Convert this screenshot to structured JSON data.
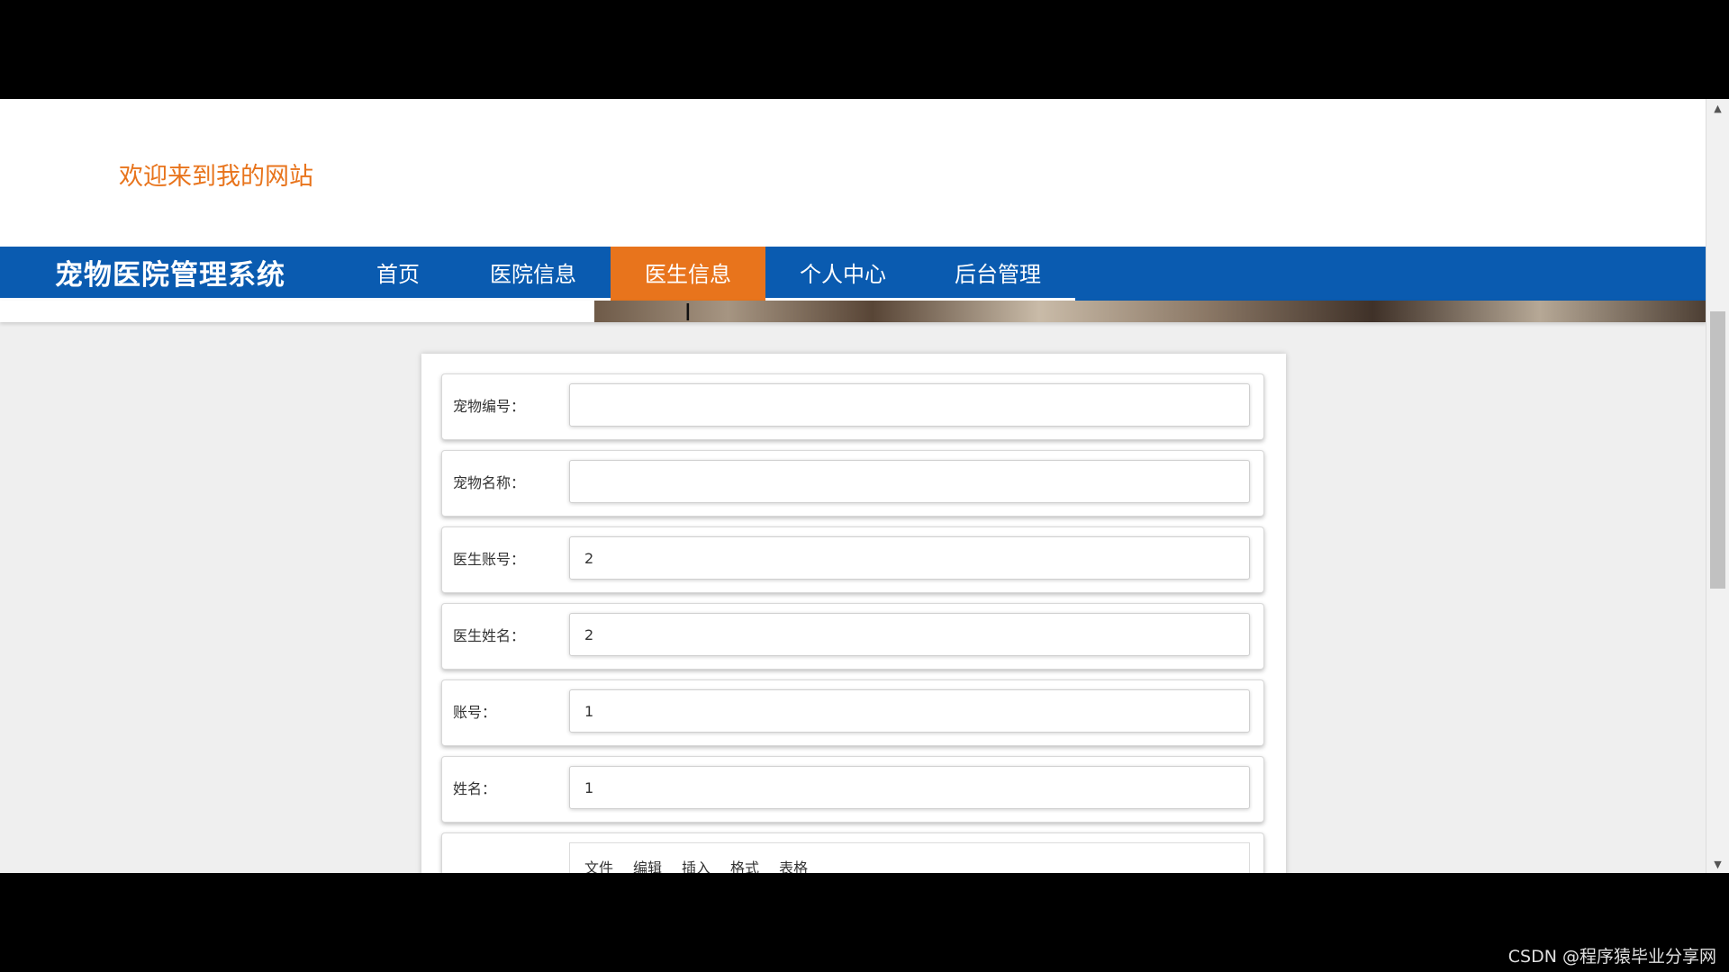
{
  "header": {
    "welcome": "欢迎来到我的网站"
  },
  "nav": {
    "brand": "宠物医院管理系统",
    "items": [
      {
        "label": "首页",
        "active": false
      },
      {
        "label": "医院信息",
        "active": false
      },
      {
        "label": "医生信息",
        "active": true
      },
      {
        "label": "个人中心",
        "active": false
      },
      {
        "label": "后台管理",
        "active": false
      }
    ]
  },
  "form": {
    "fields": [
      {
        "label": "宠物编号：",
        "value": ""
      },
      {
        "label": "宠物名称：",
        "value": ""
      },
      {
        "label": "医生账号：",
        "value": "2"
      },
      {
        "label": "医生姓名：",
        "value": "2"
      },
      {
        "label": "账号：",
        "value": "1"
      },
      {
        "label": "姓名：",
        "value": "1"
      }
    ],
    "editor_menu": [
      "文件",
      "编辑",
      "插入",
      "格式",
      "表格"
    ]
  },
  "watermark": "CSDN @程序猿毕业分享网",
  "colors": {
    "nav_bg": "#0a5bb0",
    "accent": "#e8741c"
  }
}
